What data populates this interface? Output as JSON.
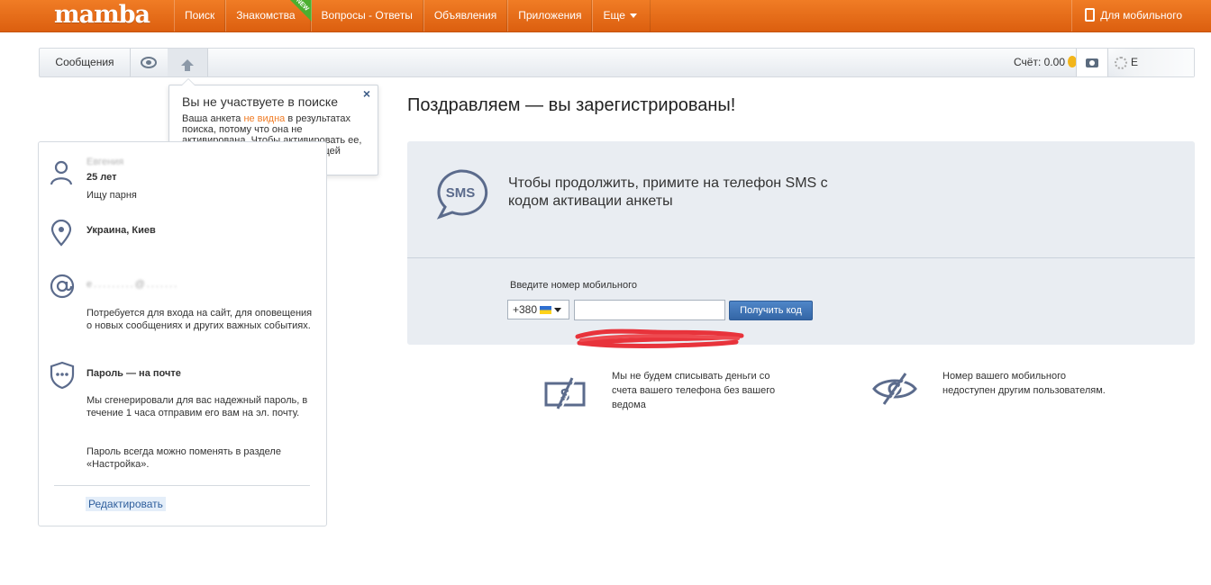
{
  "header": {
    "logo": "mamba",
    "nav": [
      {
        "label": "Поиск"
      },
      {
        "label": "Знакомства",
        "badge": "NEW"
      },
      {
        "label": "Вопросы - Ответы"
      },
      {
        "label": "Объявления"
      },
      {
        "label": "Приложения"
      },
      {
        "label": "Еще"
      }
    ],
    "mobile_label": "Для мобильного"
  },
  "subbar": {
    "messages_label": "Сообщения",
    "account_label": "Счёт: 0.00",
    "user_initial": "Е"
  },
  "tooltip": {
    "title": "Вы не участвуете в поиске",
    "body_before": "Ваша анкета ",
    "body_highlight": "не видна",
    "body_after": " в результатах поиска, потому что она не активирована. Чтобы активировать ее, следуйте инструкциям на текущей странице.",
    "close": "×"
  },
  "profile": {
    "name": "Евгения",
    "age": "25 лет",
    "seeking": "Ищу парня",
    "city": "Украина, Киев",
    "email": "e.........@.......",
    "email_note": "Потребуется для входа на сайт, для оповещения о новых сообщениях и других важных событиях.",
    "password_title": "Пароль — на почте",
    "password_note": "Мы сгенерировали для вас надежный пароль, в течение 1 часа отправим его вам на эл. почту.",
    "password_note2": "Пароль всегда можно поменять в разделе «Настройка».",
    "edit_label": "Редактировать"
  },
  "main": {
    "congrats": "Поздравляем — вы зарегистрированы!",
    "sms_icon_text": "SMS",
    "sms_text": "Чтобы продолжить, примите на телефон SMS с кодом активации анкеты",
    "phone_label": "Введите номер мобильного",
    "country_code": "+380",
    "phone_value": "",
    "phone_placeholder": "",
    "get_code_label": "Получить код",
    "info1": "Мы не будем списывать деньги со счета вашего телефона без вашего ведома",
    "info2": "Номер вашего мобильного недоступен другим пользователям."
  },
  "colors": {
    "topbar": "#e8701b",
    "accent": "#f07c25",
    "button": "#3f74b8",
    "panel": "#e9edf2",
    "icon": "#5b6b8c"
  }
}
